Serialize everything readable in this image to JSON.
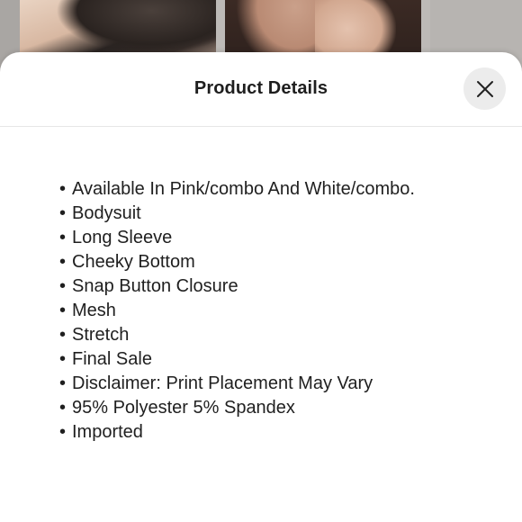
{
  "modal": {
    "title": "Product Details",
    "close_icon": "close-icon"
  },
  "details": {
    "bullet": "•",
    "items": [
      "Available In Pink/combo And White/combo.",
      "Bodysuit",
      "Long Sleeve",
      "Cheeky Bottom",
      "Snap Button Closure",
      "Mesh",
      "Stretch",
      "Final Sale",
      "Disclaimer: Print Placement May Vary",
      "95% Polyester 5% Spandex",
      "Imported"
    ]
  },
  "colors": {
    "sheet_background": "#ffffff",
    "close_button_background": "#ececec",
    "text": "#1f1f1f"
  }
}
